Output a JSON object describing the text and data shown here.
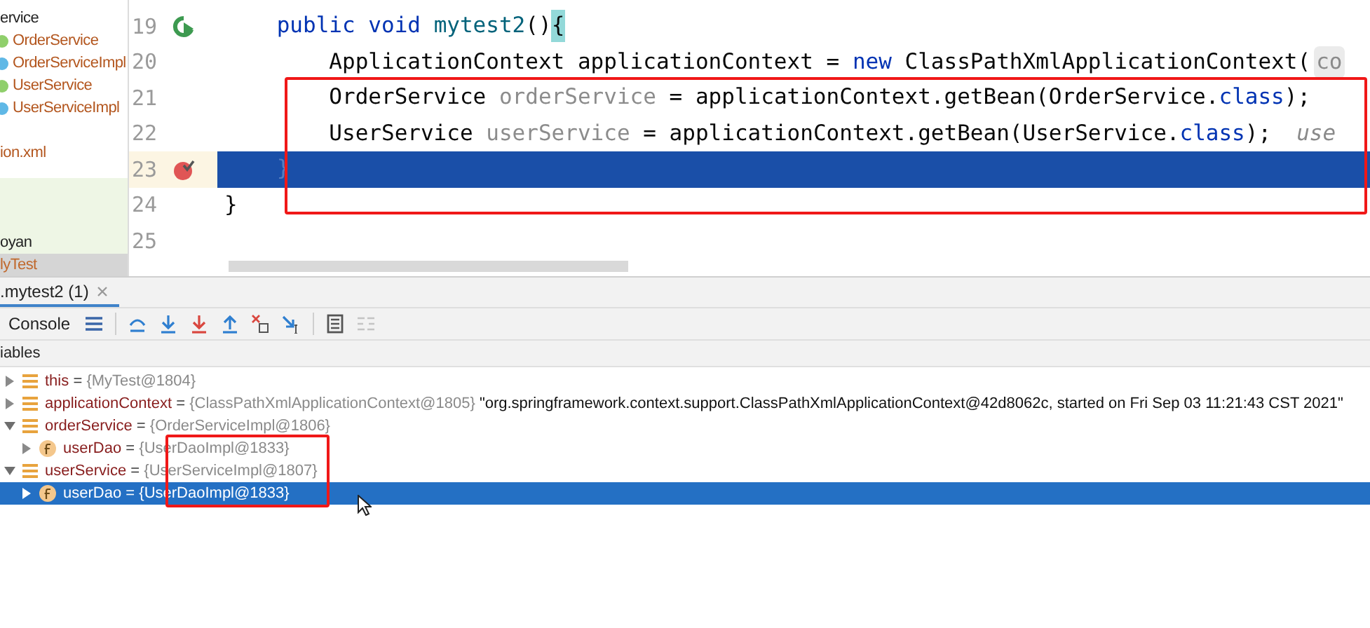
{
  "project_tree": {
    "items": [
      {
        "label": "ervice",
        "kind": "folder",
        "selected": false
      },
      {
        "label": "OrderService",
        "kind": "interface",
        "selected": false
      },
      {
        "label": "OrderServiceImpl",
        "kind": "class",
        "selected": false
      },
      {
        "label": "UserService",
        "kind": "interface",
        "selected": false
      },
      {
        "label": "UserServiceImpl",
        "kind": "class",
        "selected": false
      },
      {
        "label": "ion.xml",
        "kind": "file",
        "selected": false
      }
    ],
    "lower_items": [
      {
        "label": "oyan",
        "kind": "folder",
        "selected": false
      },
      {
        "label": "lyTest",
        "kind": "file",
        "selected": true
      }
    ]
  },
  "editor": {
    "lines": [
      {
        "number": "19",
        "run": true,
        "breakpoint": false,
        "selected": false,
        "tokens": [
          {
            "text": "    public void",
            "kind": "keyword"
          },
          {
            "text": " mytest2",
            "kind": "method"
          },
          {
            "text": "()",
            "kind": "plain"
          },
          {
            "text": "{",
            "kind": "matched"
          }
        ]
      },
      {
        "number": "20",
        "run": false,
        "breakpoint": false,
        "selected": false,
        "tokens": [
          {
            "text": "        ApplicationContext applicationContext = ",
            "kind": "plain"
          },
          {
            "text": "new",
            "kind": "keyword"
          },
          {
            "text": " ClassPathXmlApplicationContext(",
            "kind": "plain"
          },
          {
            "text": "co",
            "kind": "hint"
          }
        ]
      },
      {
        "number": "21",
        "run": false,
        "breakpoint": false,
        "selected": false,
        "tokens": [
          {
            "text": "        OrderService ",
            "kind": "plain"
          },
          {
            "text": "orderService",
            "kind": "unused"
          },
          {
            "text": " = applicationContext.getBean(OrderService.",
            "kind": "plain"
          },
          {
            "text": "class",
            "kind": "keyword"
          },
          {
            "text": ");",
            "kind": "plain"
          }
        ]
      },
      {
        "number": "22",
        "run": false,
        "breakpoint": false,
        "selected": false,
        "tokens": [
          {
            "text": "        UserService ",
            "kind": "plain"
          },
          {
            "text": "userService",
            "kind": "unused"
          },
          {
            "text": " = applicationContext.getBean(UserService.",
            "kind": "plain"
          },
          {
            "text": "class",
            "kind": "keyword"
          },
          {
            "text": ");",
            "kind": "plain"
          },
          {
            "text": "use",
            "kind": "inlay"
          }
        ]
      },
      {
        "number": "23",
        "run": false,
        "breakpoint": true,
        "selected": true,
        "tokens": [
          {
            "text": "    }",
            "kind": "matched"
          }
        ]
      },
      {
        "number": "24",
        "run": false,
        "breakpoint": false,
        "selected": false,
        "tokens": [
          {
            "text": "}",
            "kind": "plain"
          }
        ]
      },
      {
        "number": "25",
        "run": false,
        "breakpoint": false,
        "selected": false
      }
    ]
  },
  "debug": {
    "tabs": [
      {
        "label": ".mytest2 (1)",
        "selected": true
      }
    ],
    "toolbar": {
      "console": "Console"
    },
    "variables_header": "iables",
    "variables": [
      {
        "kind": "variable",
        "name": "this",
        "separator": "=",
        "value": "{MyTest@1804}",
        "expanded": false,
        "selected": false
      },
      {
        "kind": "variable",
        "name": "applicationContext",
        "separator": "=",
        "value": "{ClassPathXmlApplicationContext@1805}",
        "extra": "\"org.springframework.context.support.ClassPathXmlApplicationContext@42d8062c, started on Fri Sep 03 11:21:43 CST 2021\"",
        "expanded": false,
        "selected": false
      },
      {
        "kind": "variable",
        "name": "orderService",
        "separator": "=",
        "value": "{OrderServiceImpl@1806}",
        "expanded": true,
        "selected": false,
        "children": [
          {
            "kind": "field",
            "name": "userDao",
            "separator": "=",
            "value": "{UserDaoImpl@1833}",
            "expanded": false,
            "selected": false
          }
        ]
      },
      {
        "kind": "variable",
        "name": "userService",
        "separator": "=",
        "value": "{UserServiceImpl@1807}",
        "expanded": true,
        "selected": false,
        "children": [
          {
            "kind": "field",
            "name": "userDao",
            "separator": "=",
            "value": "{UserDaoImpl@1833}",
            "expanded": false,
            "selected": true
          }
        ]
      }
    ]
  }
}
